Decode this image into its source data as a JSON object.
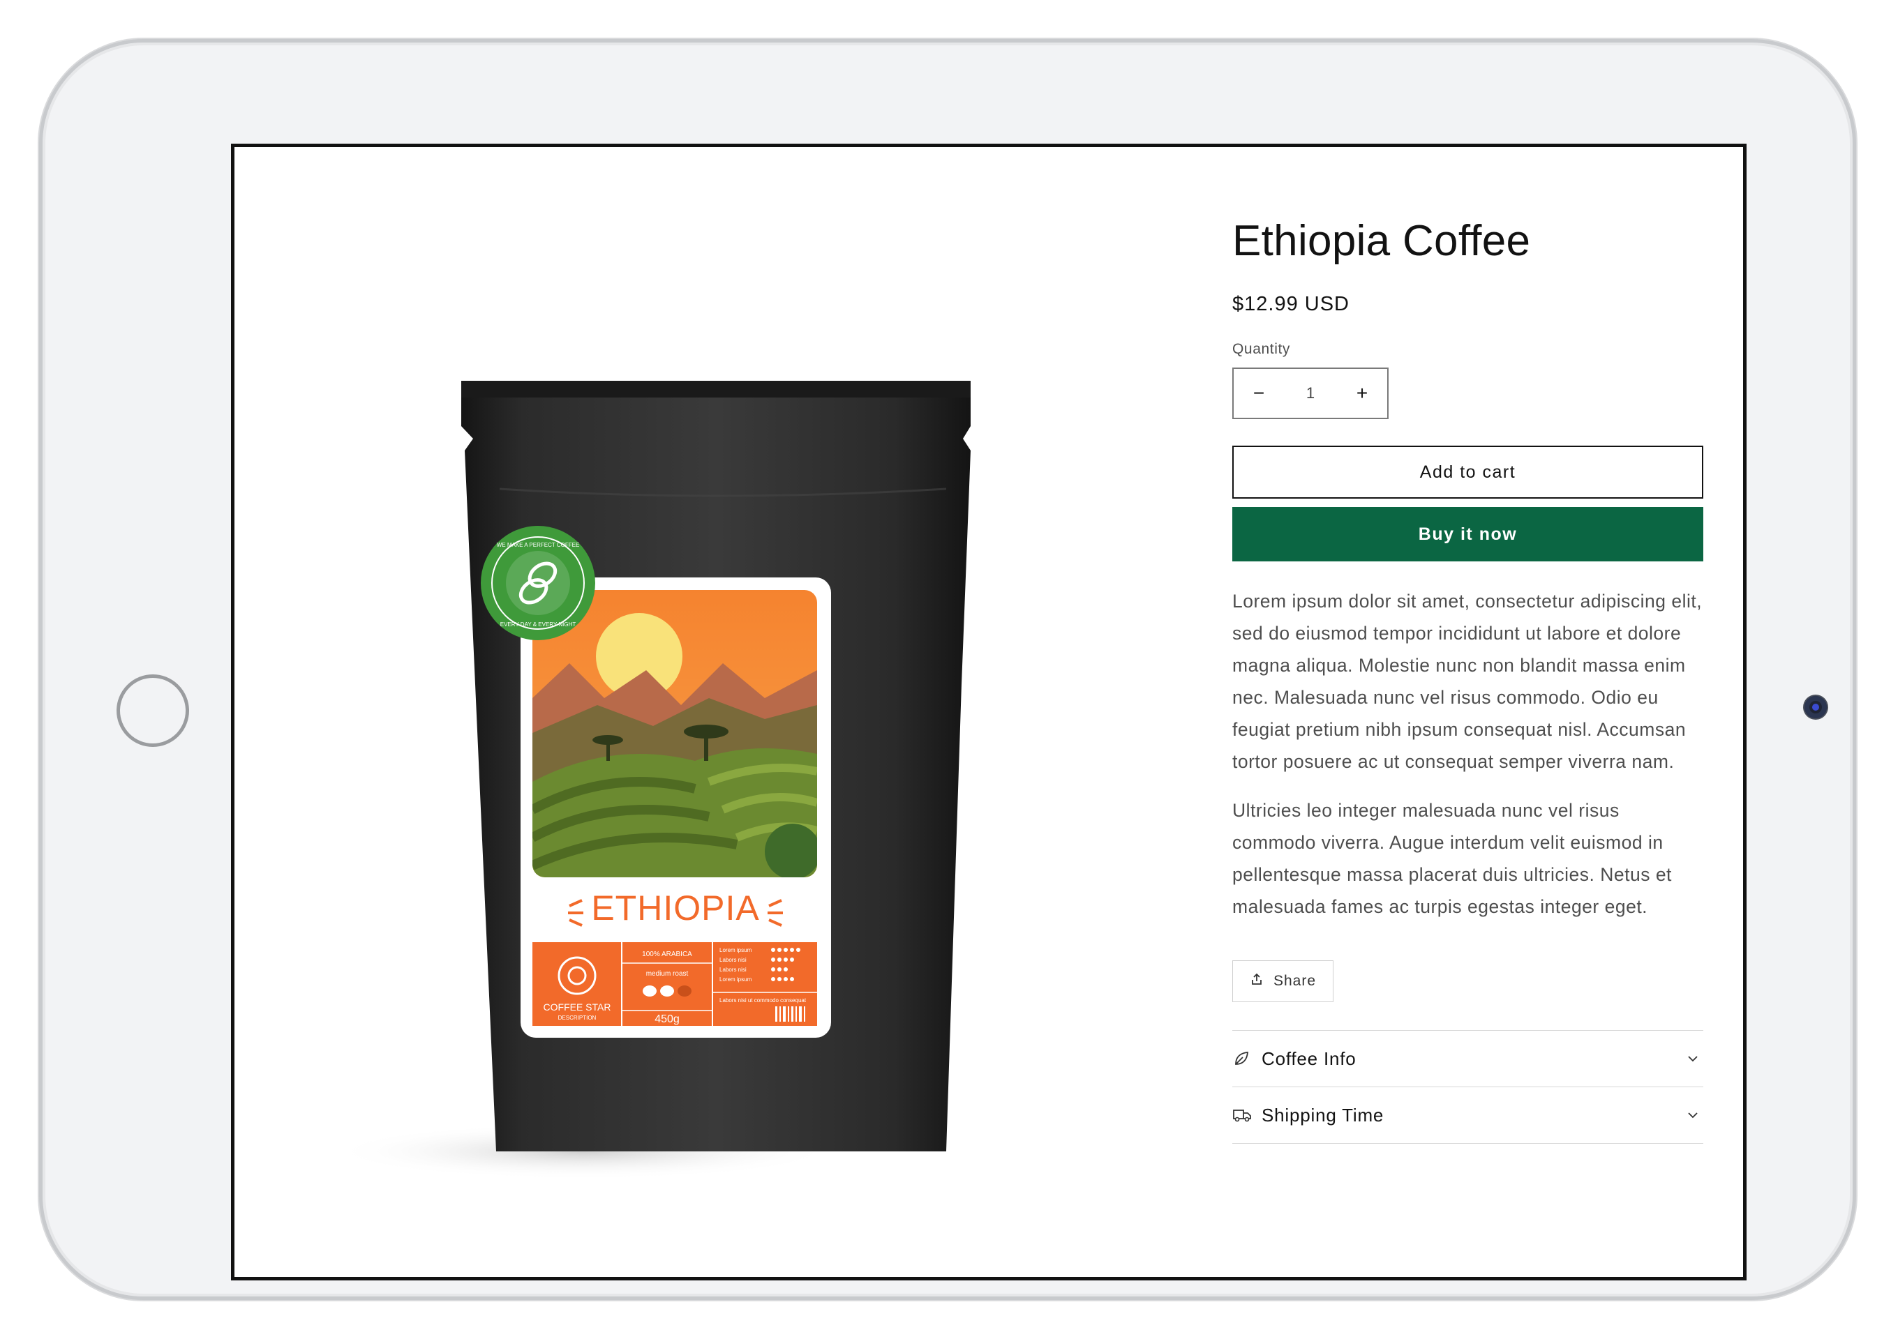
{
  "product": {
    "title": "Ethiopia Coffee",
    "price": "$12.99 USD",
    "image": {
      "badge_text_top": "WE MAKE A PERFECT COFFEE",
      "badge_text_bottom": "EVERY DAY & EVERY NIGHT",
      "label_title": "ETHIOPIA",
      "brand_name": "COFFEE STAR",
      "brand_sub": "DESCRIPTION",
      "arabica": "100% ARABICA",
      "roast": "medium roast",
      "weight": "450g",
      "rating_rows": [
        "Lorem ipsum",
        "Labors nisi",
        "Labors nisi",
        "Lorem ipsum"
      ],
      "footnote": "Labors nisi ut commodo consequat"
    }
  },
  "quantity": {
    "label": "Quantity",
    "value": "1",
    "minus": "−",
    "plus": "+"
  },
  "buttons": {
    "add_to_cart": "Add to cart",
    "buy_now": "Buy it now",
    "share": "Share"
  },
  "description": [
    "Lorem ipsum dolor sit amet, consectetur adipiscing elit, sed do eiusmod tempor incididunt ut labore et dolore magna aliqua. Molestie nunc non blandit massa enim nec. Malesuada nunc vel risus commodo. Odio eu feugiat pretium nibh ipsum consequat nisl. Accumsan tortor posuere ac ut consequat semper viverra nam.",
    "Ultricies leo integer malesuada nunc vel risus commodo viverra. Augue interdum velit euismod in pellentesque massa placerat duis ultricies. Netus et malesuada fames ac turpis egestas integer eget."
  ],
  "accordion": [
    {
      "label": "Coffee Info",
      "icon": "leaf-icon"
    },
    {
      "label": "Shipping Time",
      "icon": "truck-icon"
    }
  ],
  "colors": {
    "buy_now_bg": "#0b6643",
    "label_orange": "#f26a2a",
    "badge_green": "#3f9a3a"
  }
}
